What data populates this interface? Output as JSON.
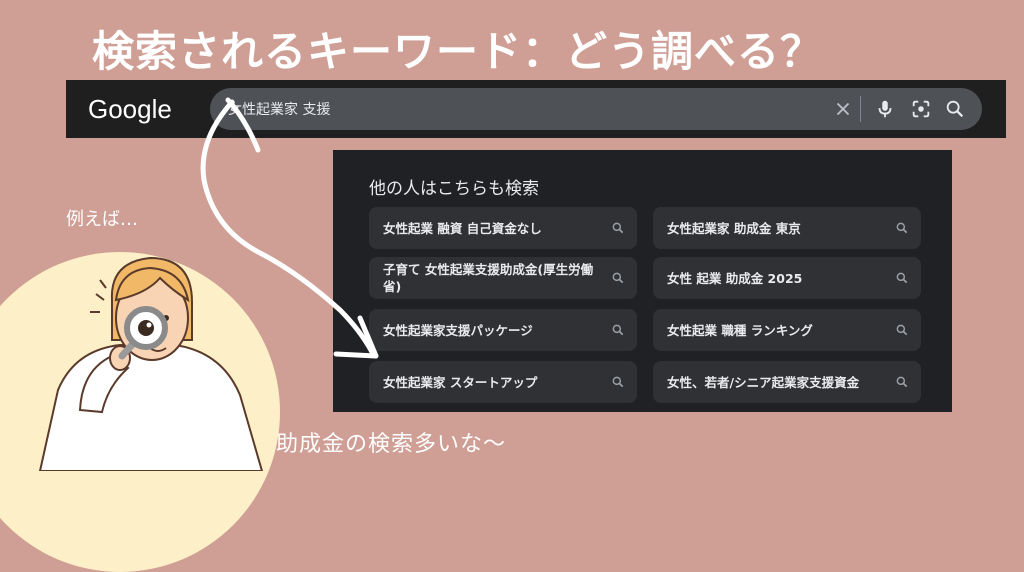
{
  "headline": "検索されるキーワード：どう調べる？",
  "browser": {
    "logo": "Google",
    "query": "女性起業家 支援",
    "icons": [
      "close-icon",
      "mic-icon",
      "lens-icon",
      "search-icon"
    ]
  },
  "related": {
    "title": "他の人はこちらも検索",
    "items": [
      {
        "label": "女性起業 融資 自己資金なし"
      },
      {
        "label": "女性起業家 助成金 東京"
      },
      {
        "label": "子育て 女性起業支援助成金(厚生労働省)"
      },
      {
        "label": "女性 起業 助成金 2025"
      },
      {
        "label": "女性起業家支援パッケージ"
      },
      {
        "label": "女性起業 職種 ランキング"
      },
      {
        "label": "女性起業家 スタートアップ"
      },
      {
        "label": "女性、若者/シニア起業家支援資金"
      }
    ]
  },
  "annotations": {
    "example": "例えば…",
    "comment": "助成金の検索多いな〜"
  },
  "colors": {
    "background": "#cf9e95",
    "searchbar": "#1f1f1f",
    "panel": "#202124",
    "chip": "#303134",
    "illustration_circle": "#fdf0c8"
  }
}
